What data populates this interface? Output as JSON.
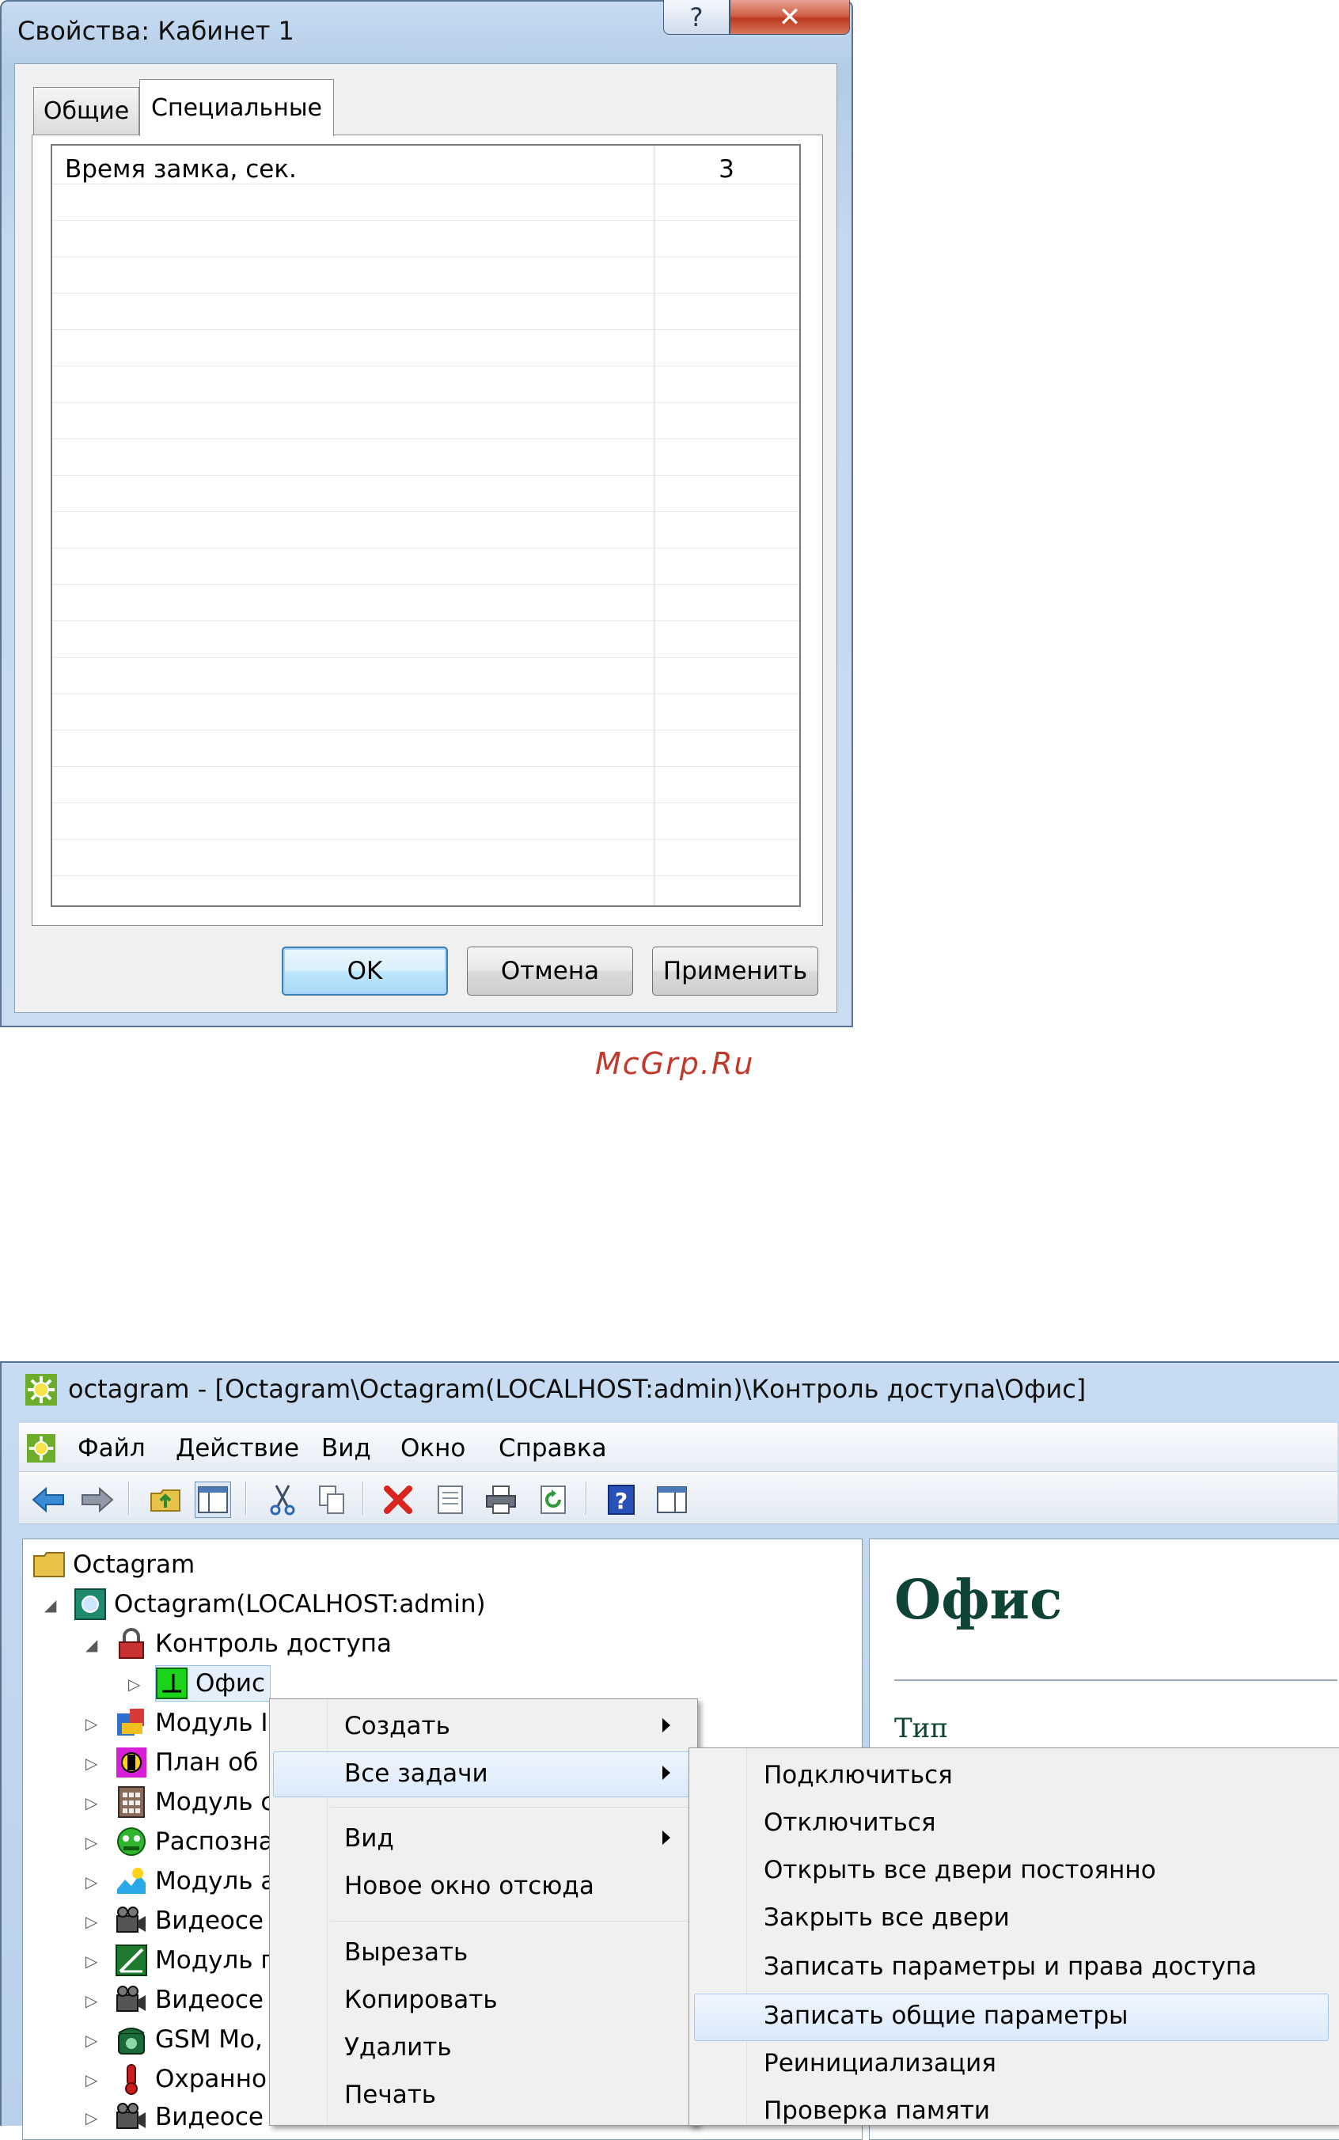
{
  "dialog": {
    "title": "Свойства: Кабинет 1",
    "help_symbol": "?",
    "close_symbol": "✕",
    "tabs": [
      {
        "label": "Общие",
        "selected": false
      },
      {
        "label": "Специальные",
        "selected": true
      }
    ],
    "property_rows": [
      {
        "name": "Время замка, сек.",
        "value": "3"
      }
    ],
    "buttons": {
      "ok": "OK",
      "cancel": "Отмена",
      "apply": "Применить"
    }
  },
  "watermark": "McGrp.Ru",
  "mmc": {
    "window_title": "octagram - [Octagram\\Octagram(LOCALHOST:admin)\\Контроль доступа\\Офис]",
    "menu": [
      "Файл",
      "Действие",
      "Вид",
      "Окно",
      "Справка"
    ],
    "toolbar_icons": [
      "back-arrow-icon",
      "forward-arrow-icon",
      "up-folder-icon",
      "show-hide-tree-icon",
      "cut-icon",
      "copy-icon",
      "delete-icon",
      "properties-icon",
      "print-icon",
      "refresh-icon",
      "help-icon",
      "action-pane-icon"
    ],
    "tree": [
      {
        "label": "Octagram",
        "icon": "folder-icon"
      },
      {
        "label": "Octagram(LOCALHOST:admin)",
        "icon": "server-node-icon"
      },
      {
        "label": "Контроль доступа",
        "icon": "lock-icon"
      },
      {
        "label": "Офис",
        "icon": "door-icon",
        "selected": true
      },
      {
        "label": "Модуль I",
        "icon": "module-icon"
      },
      {
        "label": "План об",
        "icon": "plan-icon"
      },
      {
        "label": "Модуль с",
        "icon": "keypad-icon"
      },
      {
        "label": "Распозна",
        "icon": "recognition-icon"
      },
      {
        "label": "Модуль а",
        "icon": "alarm-module-icon"
      },
      {
        "label": "Видеосе",
        "icon": "camera-icon"
      },
      {
        "label": "Модуль г",
        "icon": "chart-module-icon"
      },
      {
        "label": "Видеосе",
        "icon": "camera-icon"
      },
      {
        "label": "GSM Мо,",
        "icon": "phone-icon"
      },
      {
        "label": "Охранно",
        "icon": "security-icon"
      },
      {
        "label": "Видеосе",
        "icon": "camera-icon"
      }
    ],
    "right_pane": {
      "heading": "Офис",
      "type_label": "Тип"
    },
    "context_menu": {
      "items": [
        "Создать",
        "Все задачи",
        "Вид",
        "Новое окно отсюда",
        "Вырезать",
        "Копировать",
        "Удалить",
        "Печать"
      ],
      "highlighted": "Все задачи"
    },
    "submenu": {
      "items": [
        "Подключиться",
        "Отключиться",
        "Открыть все двери постоянно",
        "Закрыть все двери",
        "Записать параметры и права доступа",
        "Записать общие параметры",
        "Реинициализация",
        "Проверка памяти"
      ],
      "highlighted": "Записать общие параметры"
    }
  }
}
